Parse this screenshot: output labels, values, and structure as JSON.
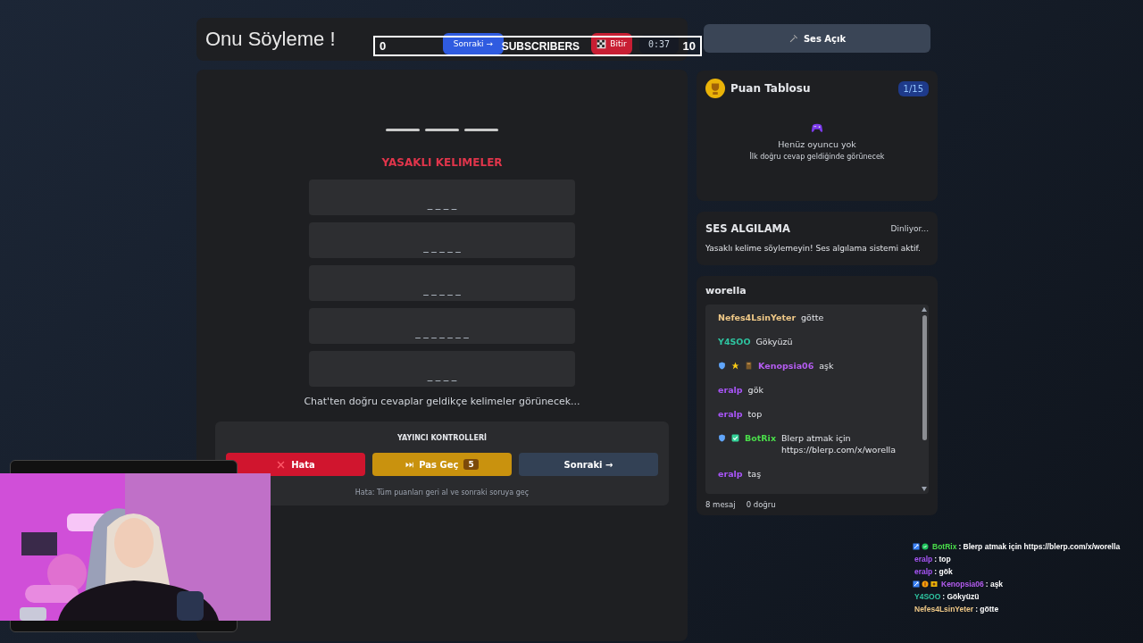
{
  "header": {
    "title": "Onu Söyleme !",
    "buttons": [
      {
        "kind": "next",
        "label": "Sonraki →"
      },
      {
        "kind": "finish",
        "label": "Bitir"
      }
    ],
    "timer": "0:37"
  },
  "sound_button": {
    "label": "Ses Açık"
  },
  "subscriber_goal": {
    "current": "0",
    "label": "SUBSCRIBERS",
    "target": "10"
  },
  "game": {
    "answer_slots": [
      {
        "kind": "blank"
      },
      {
        "kind": "blank"
      },
      {
        "kind": "blank"
      }
    ],
    "forbidden_title": "YASAKLI KELIMELER",
    "forbidden_words": [
      "_ _ _ _",
      "_ _ _ _ _",
      "_ _ _ _ _",
      "_ _ _ _ _ _ _",
      "_ _ _ _"
    ],
    "hint": "Chat'ten doğru cevaplar geldikçe kelimeler görünecek...",
    "controls": {
      "title": "YAYINCI KONTROLLERİ",
      "buttons": [
        {
          "kind": "error",
          "label": "Hata"
        },
        {
          "kind": "pass",
          "label": "Pas Geç",
          "count": "5"
        },
        {
          "kind": "next",
          "label": "Sonraki →"
        }
      ],
      "note": "Hata: Tüm puanları geri al ve sonraki soruya geç"
    }
  },
  "scoreboard": {
    "title": "Puan Tablosu",
    "round": "1/15",
    "empty_title": "Henüz oyuncu yok",
    "empty_text": "İlk doğru cevap geldiğinde görünecek"
  },
  "voice": {
    "title": "SES ALGILAMA",
    "status": "Dinliyor...",
    "text": "Yasaklı kelime söylemeyin! Ses algılama sistemi aktif."
  },
  "chat": {
    "channel": "worella",
    "messages": [
      {
        "user": "Nefes4LsinYeter",
        "color": "#f0c987",
        "text": "götte"
      },
      {
        "user": "Y4SOO",
        "color": "#2ec4a0",
        "text": "Gökyüzü"
      },
      {
        "user": "Kenopsia06",
        "color": "#b45cf0",
        "text": "aşk",
        "badges": [
          {
            "kind": "shield"
          },
          {
            "kind": "star"
          },
          {
            "kind": "book"
          }
        ]
      },
      {
        "user": "eralp",
        "color": "#a855f7",
        "text": "gök"
      },
      {
        "user": "eralp",
        "color": "#a855f7",
        "text": "top"
      },
      {
        "user": "BotRix",
        "color": "#4ade4a",
        "text": "Blerp atmak için https://blerp.com/x/worella",
        "badges": [
          {
            "kind": "shield"
          },
          {
            "kind": "check"
          }
        ]
      },
      {
        "user": "eralp",
        "color": "#a855f7",
        "text": "taş"
      }
    ],
    "message_count": "8 mesaj",
    "correct_count": "0 doğru"
  },
  "stream_chat": [
    {
      "user": "BotRix",
      "color": "#4ade4a",
      "text": ": Blerp atmak için https://blerp.com/x/worella",
      "badges": [
        {
          "kind": "mod"
        },
        {
          "kind": "verified"
        }
      ]
    },
    {
      "user": "eralp",
      "color": "#a855f7",
      "text": ": top"
    },
    {
      "user": "eralp",
      "color": "#a855f7",
      "text": ": gök"
    },
    {
      "user": "Kenopsia06",
      "color": "#b45cf0",
      "text": ": aşk",
      "badges": [
        {
          "kind": "mod"
        },
        {
          "kind": "coin"
        },
        {
          "kind": "sub"
        }
      ]
    },
    {
      "user": "Y4SOO",
      "color": "#2ec4a0",
      "text": ": Gökyüzü"
    },
    {
      "user": "Nefes4LsinYeter",
      "color": "#f0c987",
      "text": ": götte"
    }
  ]
}
